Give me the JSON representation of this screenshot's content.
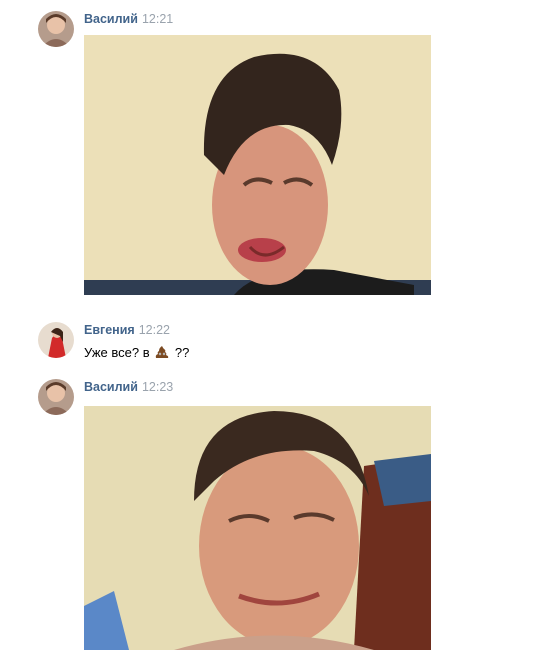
{
  "messages": [
    {
      "author": "Василий",
      "time": "12:21",
      "avatar_icon": "user-avatar-vasiliy",
      "attachment": "photo"
    },
    {
      "author": "Евгения",
      "time": "12:22",
      "avatar_icon": "user-avatar-evgeniya",
      "text_before": "Уже все? в",
      "emoji": "pile-of-poo-emoji",
      "text_after": "??"
    },
    {
      "author": "Василий",
      "time": "12:23",
      "avatar_icon": "user-avatar-vasiliy",
      "attachment": "photo"
    }
  ],
  "colors": {
    "author_link": "#42648b",
    "time": "#9aa3ad",
    "background": "#ffffff"
  }
}
